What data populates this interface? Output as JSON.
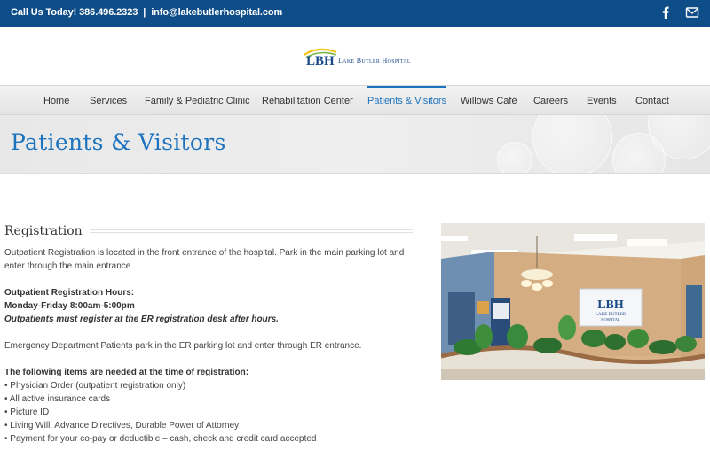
{
  "topbar": {
    "call_text": "Call Us Today! 386.496.2323",
    "separator": "|",
    "email_text": "info@lakebutlerhospital.com",
    "social_icons": [
      "facebook-icon",
      "mail-icon"
    ]
  },
  "logo": {
    "mark": "LBH",
    "name": "Lake Butler Hospital"
  },
  "nav": {
    "items": [
      {
        "label": "Home"
      },
      {
        "label": "Services"
      },
      {
        "label": "Family & Pediatric Clinic"
      },
      {
        "label": "Rehabilitation Center"
      },
      {
        "label": "Patients & Visitors",
        "active": true
      },
      {
        "label": "Willows Café"
      },
      {
        "label": "Careers"
      },
      {
        "label": "Events"
      },
      {
        "label": "Contact"
      }
    ],
    "active_color": "#1e73be"
  },
  "hero": {
    "title": "Patients & Visitors"
  },
  "registration": {
    "heading": "Registration",
    "intro": "Outpatient Registration is located in the front entrance of the hospital. Park in the main parking lot and enter through the main entrance.",
    "hours_heading": "Outpatient Registration Hours:",
    "hours": "Monday-Friday 8:00am-5:00pm",
    "after_hours_note": "Outpatients must register at the ER registration desk after hours.",
    "emergency_text": "Emergency Department Patients park in the ER parking lot and enter through ER entrance.",
    "items_heading": "The following items are needed at the time of registration:",
    "items": [
      "• Physician Order (outpatient registration only)",
      "• All active insurance cards",
      "• Picture ID",
      "• Living Will, Advance Directives, Durable Power of Attorney",
      "• Payment for your co-pay or deductible – cash, check and credit card accepted"
    ]
  },
  "photo": {
    "sign_mark": "LBH",
    "sign_line1": "LAKE BUTLER",
    "sign_line2": "HOSPITAL"
  },
  "colors": {
    "topbar_bg": "#0f4d88",
    "accent": "#1e73be"
  }
}
